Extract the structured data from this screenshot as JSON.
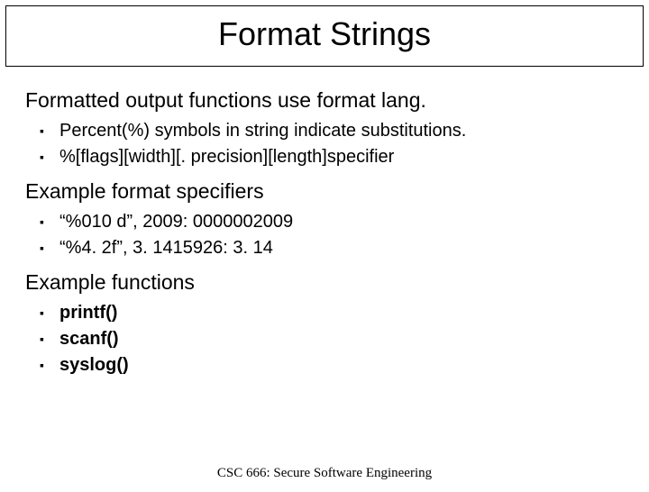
{
  "slide": {
    "title": "Format Strings",
    "section1": {
      "heading": "Formatted output functions use format lang.",
      "items": [
        "Percent(%) symbols in string indicate substitutions.",
        "%[flags][width][. precision][length]specifier"
      ]
    },
    "section2": {
      "heading": "Example format specifiers",
      "items": [
        "“%010 d”, 2009: 0000002009",
        "“%4. 2f”, 3. 1415926: 3. 14"
      ]
    },
    "section3": {
      "heading": "Example functions",
      "items": [
        "printf()",
        "scanf()",
        "syslog()"
      ]
    },
    "footer": "CSC 666: Secure Software Engineering"
  }
}
